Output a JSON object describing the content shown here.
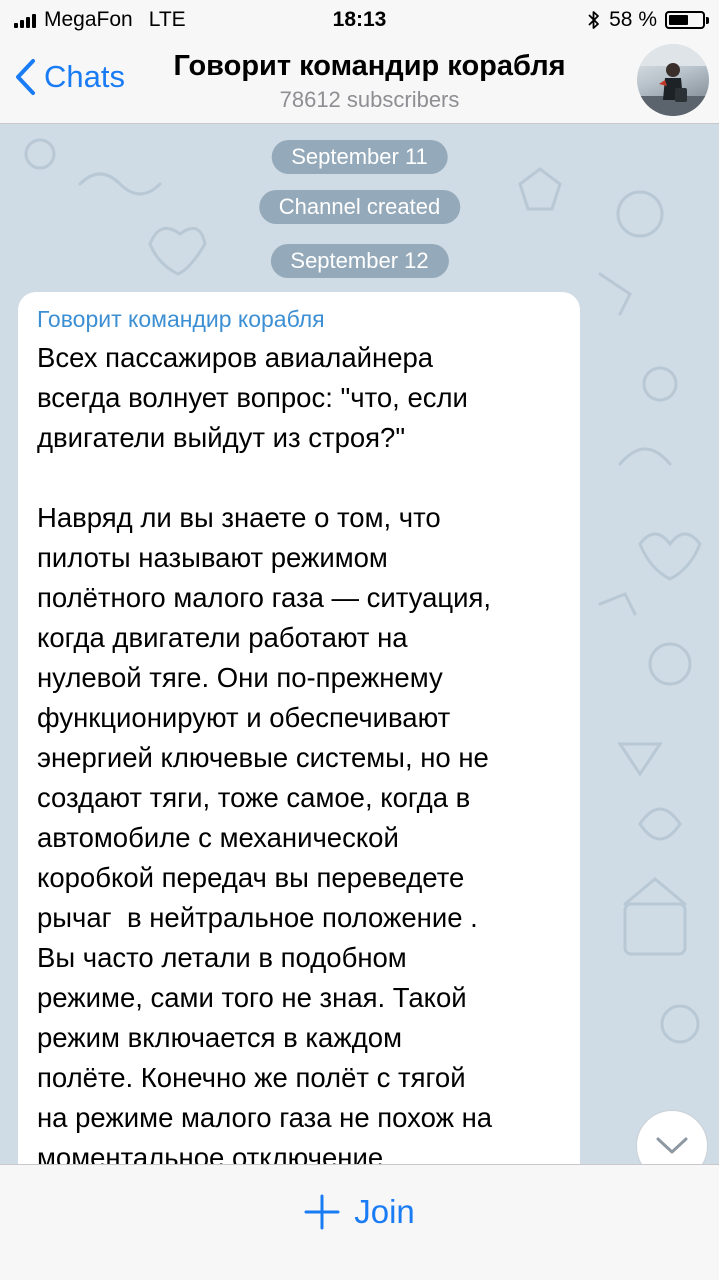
{
  "status_bar": {
    "carrier": "MegaFon",
    "network": "LTE",
    "time": "18:13",
    "battery_percent": "58 %",
    "battery_level": 0.58
  },
  "header": {
    "back_label": "Chats",
    "title": "Говорит командир корабля",
    "subtitle": "78612 subscribers"
  },
  "chat": {
    "service_messages": [
      "September 11",
      "Channel created",
      "September 12"
    ],
    "message": {
      "sender": "Говорит командир корабля",
      "text": "Всех пассажиров авиалайнера\nвсегда волнует вопрос: \"что, если\nдвигатели выйдут из строя?\"\n\nНавряд ли вы знаете о том, что\nпилоты называют режимом\nполётного малого газа — ситуация,\nкогда двигатели работают на\nнулевой тяге. Они по-прежнему\nфункционируют и обеспечивают\nэнергией ключевые системы, но не\nсоздают тяги, тоже самое, когда в\nавтомобиле с механической\nкоробкой передач вы переведете\nрычаг  в нейтральное положение .\nВы часто летали в подобном\nрежиме, сами того не зная. Такой\nрежим включается в каждом\nполёте. Конечно же полёт с тягой\nна режиме малого газа не похож на\nмоментальное отключение"
    }
  },
  "footer": {
    "join_label": "Join"
  },
  "colors": {
    "accent": "#1a7cf5",
    "sender": "#3d8fd4",
    "pill_bg": "#8aa0b2",
    "wallpaper": "#cfdbe5"
  },
  "icons": [
    "signal-icon",
    "bluetooth-icon",
    "battery-icon",
    "back-chevron-icon",
    "chevron-down-icon",
    "plus-icon"
  ]
}
